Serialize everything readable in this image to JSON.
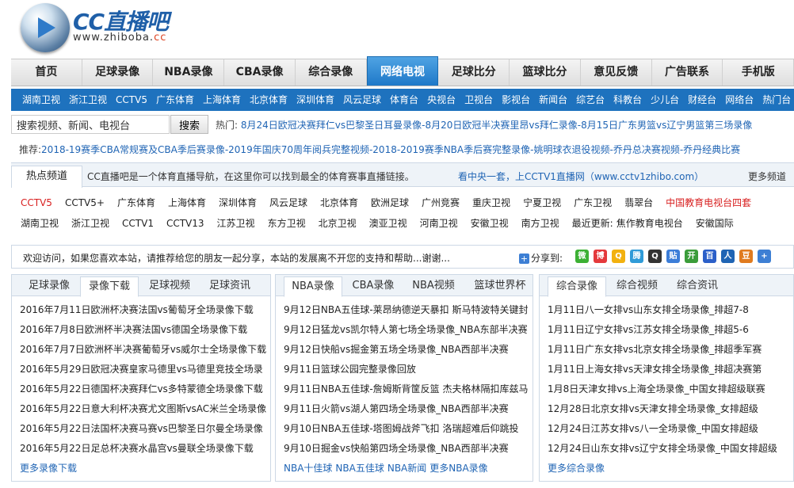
{
  "logo": {
    "title": "CC直播吧",
    "url_prefix": "www.zhiboba.",
    "url_suffix": "cc"
  },
  "main_nav": [
    "首页",
    "足球录像",
    "NBA录像",
    "CBA录像",
    "综合录像",
    "网络电视",
    "足球比分",
    "篮球比分",
    "意见反馈",
    "广告联系",
    "手机版"
  ],
  "main_nav_active": 5,
  "sub_nav": [
    "湖南卫视",
    "浙江卫视",
    "CCTV5",
    "广东体育",
    "上海体育",
    "北京体育",
    "深圳体育",
    "风云足球",
    "体育台",
    "央视台",
    "卫视台",
    "影视台",
    "新闻台",
    "综艺台",
    "科教台",
    "少儿台",
    "财经台",
    "网络台",
    "热门台"
  ],
  "search": {
    "value": "搜索视频、新闻、电视台",
    "button": "搜索"
  },
  "hot": {
    "label": "热门:",
    "links": [
      "8月24日欧冠决赛拜仁vs巴黎圣日耳曼录像",
      "-8月20日欧冠半决赛里昂vs拜仁录像",
      "-8月15日广东男篮vs辽宁男篮第三场录像"
    ]
  },
  "recommend": {
    "label": "推荐:",
    "links": [
      "2018-19赛季CBA常规赛及CBA季后赛录像",
      "-2019年国庆70周年阅兵完整视频",
      "-2018-2019赛季NBA季后赛完整录像",
      "-姚明球衣退役视频",
      "-乔丹总决赛视频",
      "-乔丹经典比赛"
    ]
  },
  "hot_channels": {
    "tab": "热点频道",
    "desc": "CC直播吧是一个体育直播导航，在这里你可以找到最全的体育赛事直播链接。",
    "tv_link": "看中央一套，上CCTV1直播网（www.cctv1zhibo.com）",
    "more": "更多频道",
    "row1": [
      "CCTV5",
      "CCTV5+",
      "广东体育",
      "上海体育",
      "深圳体育",
      "风云足球",
      "北京体育",
      "欧洲足球",
      "广州竞赛",
      "重庆卫视",
      "宁夏卫视",
      "广东卫视",
      "翡翠台",
      "中国教育电视台四套"
    ],
    "row2": [
      "湖南卫视",
      "浙江卫视",
      "CCTV1",
      "CCTV13",
      "江苏卫视",
      "东方卫视",
      "北京卫视",
      "澳亚卫视",
      "河南卫视",
      "安徽卫视",
      "南方卫视",
      "最近更新:",
      "焦作教育电视台",
      "安徽国际"
    ],
    "red_color": "#d82020"
  },
  "share": {
    "text": "欢迎访问，如果您喜欢本站，请推荐给您的朋友一起分享，本站的发展离不开您的支持和帮助...谢谢...",
    "label": "分享到:",
    "icons": [
      {
        "name": "wechat-icon",
        "color": "#3cb034",
        "glyph": "微"
      },
      {
        "name": "weibo-icon",
        "color": "#e4393c",
        "glyph": "博"
      },
      {
        "name": "qzone-icon",
        "color": "#f2b10f",
        "glyph": "Q"
      },
      {
        "name": "tencent-weibo-icon",
        "color": "#2f9bd8",
        "glyph": "腾"
      },
      {
        "name": "qq-icon",
        "color": "#333333",
        "glyph": "Q"
      },
      {
        "name": "tieba-icon",
        "color": "#3b7dd8",
        "glyph": "贴"
      },
      {
        "name": "kaixin-icon",
        "color": "#3a9c3a",
        "glyph": "开"
      },
      {
        "name": "baidu-icon",
        "color": "#2b5fc9",
        "glyph": "百"
      },
      {
        "name": "renren-icon",
        "color": "#1f64b4",
        "glyph": "人"
      },
      {
        "name": "douban-icon",
        "color": "#e07b1f",
        "glyph": "豆"
      },
      {
        "name": "more-share-icon",
        "color": "#3d7fd4",
        "glyph": "+"
      }
    ]
  },
  "panels": [
    {
      "tabs": [
        "足球录像",
        "录像下载",
        "足球视频",
        "足球资讯"
      ],
      "active": 1,
      "items": [
        "2016年7月11日欧洲杯决赛法国vs葡萄牙全场录像下载",
        "2016年7月8日欧洲杯半决赛法国vs德国全场录像下载",
        "2016年7月7日欧洲杯半决赛葡萄牙vs威尔士全场录像下载",
        "2016年5月29日欧冠决赛皇家马德里vs马德里竞技全场录",
        "2016年5月22日德国杯决赛拜仁vs多特蒙德全场录像下载",
        "2016年5月22日意大利杯决赛尤文图斯vsAC米兰全场录像",
        "2016年5月22日法国杯决赛马赛vs巴黎圣日尔曼全场录像",
        "2016年5月22日足总杯决赛水晶宫vs曼联全场录像下载"
      ],
      "more": [
        "更多录像下载"
      ]
    },
    {
      "tabs": [
        "NBA录像",
        "CBA录像",
        "NBA视频",
        "篮球世界杯"
      ],
      "active": 0,
      "items": [
        "9月12日NBA五佳球-莱昂纳德逆天暴扣 斯马特波特关键封",
        "9月12日猛龙vs凯尔特人第七场全场录像_NBA东部半决赛",
        "9月12日快船vs掘金第五场全场录像_NBA西部半决赛",
        "9月11日篮球公园完整录像回放",
        "9月11日NBA五佳球-詹姆斯背筐反篮 杰夫格林隔扣库兹马",
        "9月11日火箭vs湖人第四场全场录像_NBA西部半决赛",
        "9月10日NBA五佳球-塔图姆战斧飞扣 洛瑞超难后仰跳投",
        "9月10日掘金vs快船第四场全场录像_NBA西部半决赛"
      ],
      "more": [
        "NBA十佳球",
        "NBA五佳球",
        "NBA新闻",
        "更多NBA录像"
      ]
    },
    {
      "tabs": [
        "综合录像",
        "综合视频",
        "综合资讯"
      ],
      "active": 0,
      "items": [
        "1月11日八一女排vs山东女排全场录像_排超7-8",
        "1月11日辽宁女排vs江苏女排全场录像_排超5-6",
        "1月11日广东女排vs北京女排全场录像_排超季军赛",
        "1月11日上海女排vs天津女排全场录像_排超决赛第",
        "1月8日天津女排vs上海全场录像_中国女排超级联赛",
        "12月28日北京女排vs天津女排全场录像_女排超级",
        "12月24日江苏女排vs八一全场录像_中国女排超级",
        "12月24日山东女排vs辽宁女排全场录像_中国女排超级"
      ],
      "more": [
        "更多综合录像"
      ]
    }
  ]
}
